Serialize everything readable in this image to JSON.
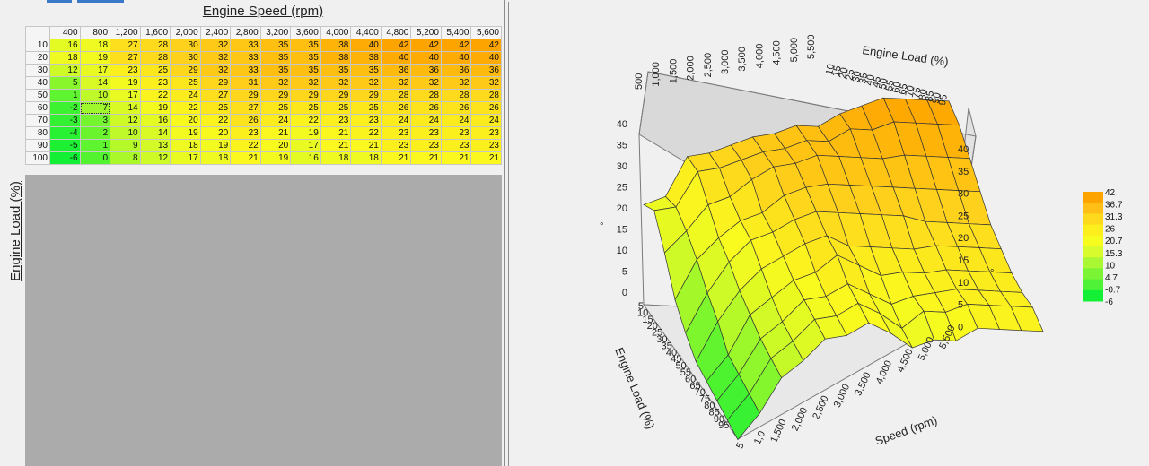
{
  "table": {
    "x_title": "Engine Speed (rpm)",
    "y_title": "Engine Load (%)",
    "columns": [
      "400",
      "800",
      "1,200",
      "1,600",
      "2,000",
      "2,400",
      "2,800",
      "3,200",
      "3,600",
      "4,000",
      "4,400",
      "4,800",
      "5,200",
      "5,400",
      "5,600"
    ],
    "rows": [
      {
        "load": "10",
        "values": [
          16,
          18,
          27,
          28,
          30,
          32,
          33,
          35,
          35,
          38,
          40,
          42,
          42,
          42,
          42
        ]
      },
      {
        "load": "20",
        "values": [
          18,
          19,
          27,
          28,
          30,
          32,
          33,
          35,
          35,
          38,
          38,
          40,
          40,
          40,
          40
        ]
      },
      {
        "load": "30",
        "values": [
          12,
          17,
          23,
          25,
          29,
          32,
          33,
          35,
          35,
          35,
          35,
          36,
          36,
          36,
          36
        ]
      },
      {
        "load": "40",
        "values": [
          5,
          14,
          19,
          23,
          25,
          29,
          31,
          32,
          32,
          32,
          32,
          32,
          32,
          32,
          32
        ]
      },
      {
        "load": "50",
        "values": [
          1,
          10,
          17,
          22,
          24,
          27,
          29,
          29,
          29,
          29,
          29,
          28,
          28,
          28,
          28
        ]
      },
      {
        "load": "60",
        "values": [
          -2,
          7,
          14,
          19,
          22,
          25,
          27,
          25,
          25,
          25,
          25,
          26,
          26,
          26,
          26
        ]
      },
      {
        "load": "70",
        "values": [
          -3,
          3,
          12,
          16,
          20,
          22,
          26,
          24,
          22,
          23,
          23,
          24,
          24,
          24,
          24
        ]
      },
      {
        "load": "80",
        "values": [
          -4,
          2,
          10,
          14,
          19,
          20,
          23,
          21,
          19,
          21,
          22,
          23,
          23,
          23,
          23
        ]
      },
      {
        "load": "90",
        "values": [
          -5,
          1,
          9,
          13,
          18,
          19,
          22,
          20,
          17,
          21,
          21,
          23,
          23,
          23,
          23
        ]
      },
      {
        "load": "100",
        "values": [
          -6,
          0,
          8,
          12,
          17,
          18,
          21,
          19,
          16,
          18,
          18,
          21,
          21,
          21,
          21
        ]
      }
    ],
    "selected_cell": "60 / 800"
  },
  "plot3d": {
    "axis_load_title": "Engine Load (%)",
    "axis_speed_title": "Speed (rpm)",
    "axis_load_title_top": "Engine Load (%)",
    "z_ticks_left": [
      "40",
      "35",
      "30",
      "25",
      "20",
      "15",
      "10",
      "5",
      "0"
    ],
    "z_ticks_right": [
      "40",
      "35",
      "30",
      "25",
      "20",
      "15",
      "10",
      "5",
      "0"
    ],
    "top_speed_ticks": [
      "500",
      "1,000",
      "1,500",
      "2,000",
      "2,500",
      "3,000",
      "3,500",
      "4,000",
      "4,500",
      "5,000",
      "5,500"
    ],
    "top_load_ticks": [
      "10",
      "15",
      "20",
      "25",
      "30",
      "35",
      "40",
      "45",
      "50",
      "55",
      "60",
      "65",
      "70",
      "75",
      "80",
      "85",
      "90",
      "95"
    ],
    "front_load_ticks": [
      "5",
      "10",
      "15",
      "20",
      "25",
      "30",
      "35",
      "40",
      "45",
      "50",
      "55",
      "60",
      "65",
      "70",
      "75",
      "80",
      "85",
      "90",
      "95"
    ],
    "front_speed_ticks": [
      "5",
      "1,0",
      "1,500",
      "2,000",
      "2,500",
      "3,000",
      "3,500",
      "4,000",
      "4,500",
      "5,000",
      "5,500"
    ],
    "degree_marks": [
      "°",
      "°"
    ]
  },
  "legend": {
    "values": [
      "42",
      "36.7",
      "31.3",
      "26",
      "20.7",
      "15.3",
      "10",
      "4.7",
      "-0.7",
      "-6"
    ],
    "colors": [
      "#fea400",
      "#ffbf17",
      "#fed91d",
      "#fdee1e",
      "#f6fc1d",
      "#d7fb2c",
      "#a9f833",
      "#7bf436",
      "#4ff236",
      "#12ef34"
    ]
  }
}
